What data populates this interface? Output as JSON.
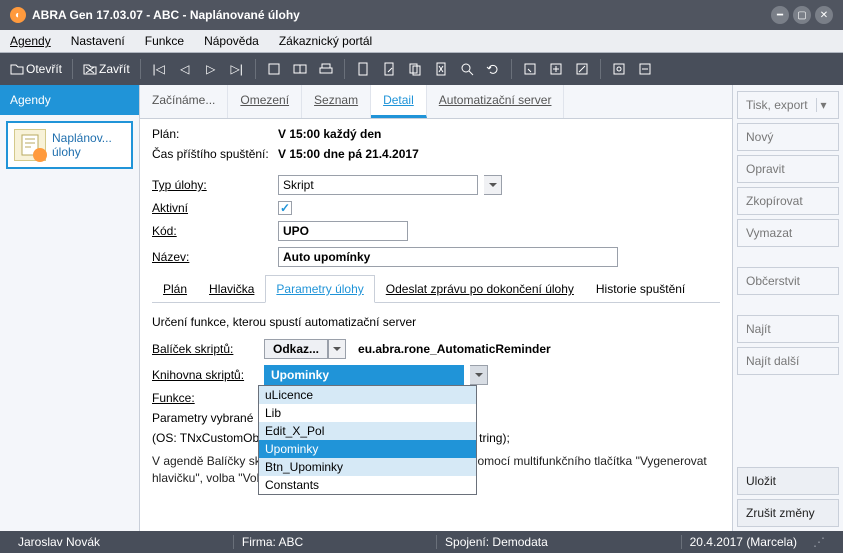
{
  "title": "ABRA Gen 17.03.07 - ABC - Naplánované úlohy",
  "menu": [
    "Agendy",
    "Nastavení",
    "Funkce",
    "Nápověda",
    "Zákaznický portál"
  ],
  "toolbar": {
    "open": "Otevřít",
    "close": "Zavřít"
  },
  "left": {
    "agendy": "Agendy",
    "task_l1": "Naplánov...",
    "task_l2": "úlohy"
  },
  "main_tabs": {
    "t0": "Začínáme...",
    "t1": "Omezení",
    "t2": "Seznam",
    "t3": "Detail",
    "t4": "Automatizační server"
  },
  "plan_label": "Plán:",
  "plan_value": "V 15:00 každý den",
  "nextrun_label": "Čas příštího spuštění:",
  "nextrun_value": "V 15:00 dne pá 21.4.2017",
  "type_label": "Typ úlohy:",
  "type_value": "Skript",
  "active_label": "Aktivní",
  "active_checked": "✓",
  "code_label": "Kód:",
  "code_value": "UPO",
  "name_label": "Název:",
  "name_value": "Auto upomínky",
  "subtabs": {
    "s0": "Plán",
    "s1": "Hlavička",
    "s2": "Parametry úlohy",
    "s3": "Odeslat zprávu po dokončení úlohy",
    "s4": "Historie spuštění"
  },
  "hint": "Určení funkce, kterou spustí automatizační server",
  "pkg_label": "Balíček skriptů:",
  "pkg_btn": "Odkaz...",
  "pkg_value": "eu.abra.rone_AutomaticReminder",
  "lib_label": "Knihovna skriptů:",
  "lib_value": "Upominky",
  "dropdown": {
    "o0": "uLicence",
    "o1": "Lib",
    "o2": "Edit_X_Pol",
    "o3": "Upominky",
    "o4": "Btn_Upominky",
    "o5": "Constants"
  },
  "func_label": "Funkce:",
  "params_label": "Parametry vybrané",
  "os_text": "(OS: TNxCustomOb",
  "os_tail": "tring);",
  "note": "V agendě Balíčky skriptů je možno připravit hlavičku funkce pomocí multifunkčního tlačítka \"Vygenerovat hlavičku\", volba \"Volání z naplánované úlohy\".",
  "rbtn": {
    "print": "Tisk, export",
    "new": "Nový",
    "edit": "Opravit",
    "copy": "Zkopírovat",
    "del": "Vymazat",
    "refresh": "Občerstvit",
    "find": "Najít",
    "findnext": "Najít další",
    "save": "Uložit",
    "cancel": "Zrušit změny"
  },
  "status": {
    "user": "Jaroslav Novák",
    "firma": "Firma: ABC",
    "conn": "Spojení: Demodata",
    "date": "20.4.2017 (Marcela)"
  }
}
